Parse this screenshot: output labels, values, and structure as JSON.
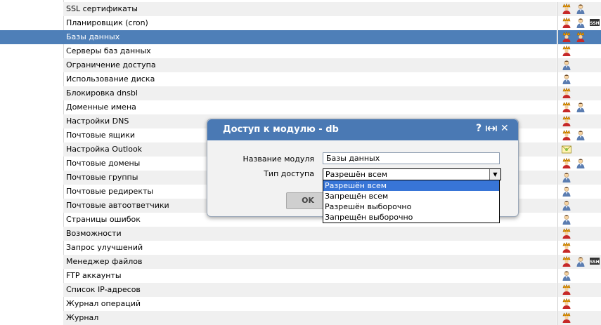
{
  "rows": [
    {
      "label": "SSL сертификаты",
      "icons": [
        "admin-icon",
        "user-icon"
      ]
    },
    {
      "label": "Планировщик (cron)",
      "icons": [
        "admin-icon",
        "user-icon",
        "ssh-icon"
      ]
    },
    {
      "label": "Базы данных",
      "icons": [
        "admin-icon",
        "admin-icon"
      ],
      "selected": true
    },
    {
      "label": "Серверы баз данных",
      "icons": [
        "admin-icon"
      ]
    },
    {
      "label": "Ограничение доступа",
      "icons": [
        "user-icon"
      ]
    },
    {
      "label": "Использование диска",
      "icons": [
        "user-icon"
      ]
    },
    {
      "label": "Блокировка dnsbl",
      "icons": [
        "admin-icon"
      ]
    },
    {
      "label": "Доменные имена",
      "icons": [
        "admin-icon",
        "user-icon"
      ]
    },
    {
      "label": "Настройки DNS",
      "icons": [
        "admin-icon"
      ]
    },
    {
      "label": "Почтовые ящики",
      "icons": [
        "admin-icon",
        "user-icon"
      ]
    },
    {
      "label": "Настройка Outlook",
      "icons": [
        "mail-icon"
      ]
    },
    {
      "label": "Почтовые домены",
      "icons": [
        "admin-icon",
        "user-icon"
      ]
    },
    {
      "label": "Почтовые группы",
      "icons": [
        "user-icon"
      ]
    },
    {
      "label": "Почтовые редиректы",
      "icons": [
        "user-icon"
      ]
    },
    {
      "label": "Почтовые автоответчики",
      "icons": [
        "user-icon"
      ]
    },
    {
      "label": "Страницы ошибок",
      "icons": [
        "user-icon"
      ]
    },
    {
      "label": "Возможности",
      "icons": [
        "admin-icon"
      ]
    },
    {
      "label": "Запрос улучшений",
      "icons": [
        "admin-icon"
      ]
    },
    {
      "label": "Менеджер файлов",
      "icons": [
        "admin-icon",
        "user-icon",
        "ssh-icon"
      ]
    },
    {
      "label": "FTP аккаунты",
      "icons": [
        "user-icon"
      ]
    },
    {
      "label": "Список IP-адресов",
      "icons": [
        "admin-icon"
      ]
    },
    {
      "label": "Журнал операций",
      "icons": [
        "admin-icon"
      ]
    },
    {
      "label": "Журнал",
      "icons": [
        "admin-icon"
      ]
    }
  ],
  "dialog": {
    "title": "Доступ к модулю - db",
    "help_label": "?",
    "close_label": "✕",
    "module_name_label": "Название модуля",
    "module_name_value": "Базы данных",
    "access_type_label": "Тип доступа",
    "access_type_value": "Разрешён всем",
    "ok_label": "OK",
    "options": [
      "Разрешён всем",
      "Запрещён всем",
      "Разрешён выборочно",
      "Запрещён выборочно"
    ],
    "active_option": 0
  },
  "colors": {
    "selected_row": "#4e7fb8",
    "dialog_header": "#4a79b4",
    "dropdown_active": "#3875d7"
  },
  "ssh_text": "SSH"
}
